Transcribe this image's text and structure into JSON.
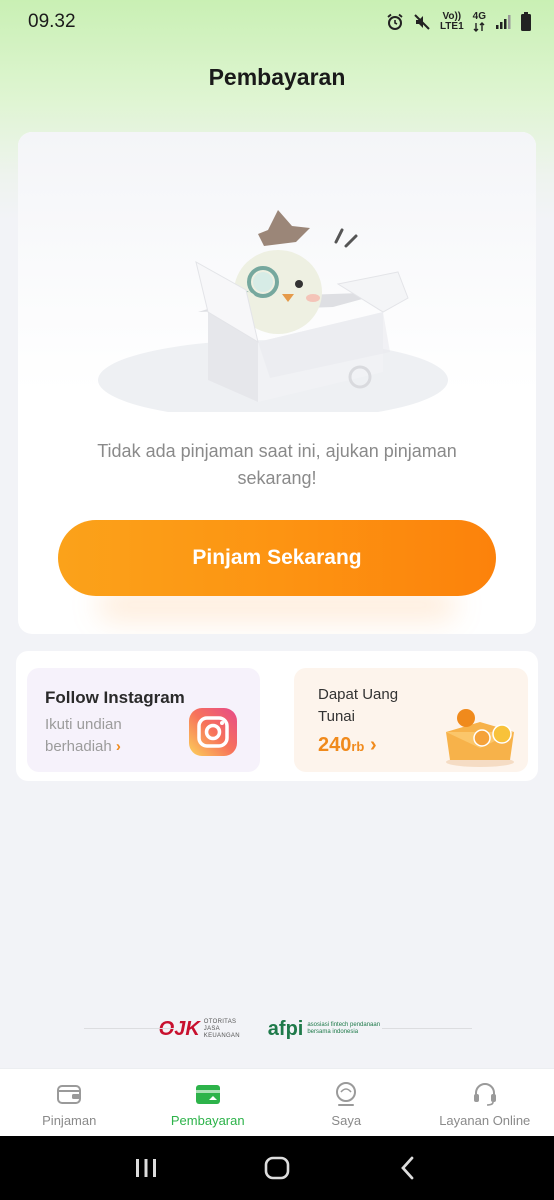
{
  "status_bar": {
    "time": "09.32",
    "volte_label": "Vo))",
    "lte_label": "LTE1",
    "network_label": "4G"
  },
  "header": {
    "title": "Pembayaran"
  },
  "empty_state": {
    "illustration": "mascot-in-box",
    "message": "Tidak ada pinjaman saat ini, ajukan pinjaman sekarang!",
    "cta_label": "Pinjam Sekarang"
  },
  "promos": {
    "instagram": {
      "title": "Follow Instagram",
      "subtitle": "Ikuti undian berhadiah",
      "icon": "instagram-icon"
    },
    "cash": {
      "title": "Dapat Uang Tunai",
      "amount": "240",
      "unit": "rb",
      "icon": "money-envelope-icon"
    }
  },
  "regulators": {
    "ojk_mark": "OJK",
    "ojk_text": "OTORITAS JASA KEUANGAN",
    "afpi_mark": "afpi",
    "afpi_text": "asosiasi fintech pendanaan bersama indonesia"
  },
  "bottom_nav": {
    "items": [
      {
        "label": "Pinjaman",
        "icon": "wallet-icon",
        "active": false
      },
      {
        "label": "Pembayaran",
        "icon": "card-icon",
        "active": true
      },
      {
        "label": "Saya",
        "icon": "profile-icon",
        "active": false
      },
      {
        "label": "Layanan Online",
        "icon": "headset-icon",
        "active": false
      }
    ]
  },
  "colors": {
    "accent_orange": "#fd9412",
    "active_green": "#2db34a",
    "header_green": "#c9f0b4"
  }
}
